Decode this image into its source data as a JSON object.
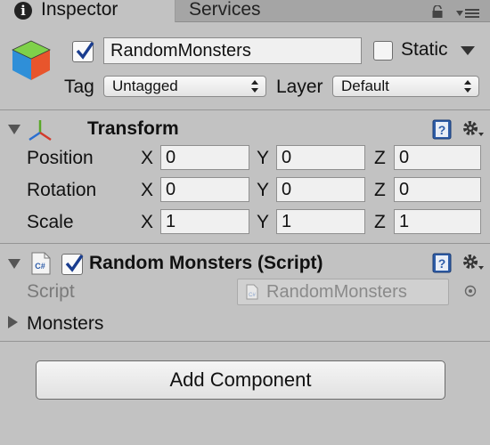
{
  "tabs": {
    "inspector": "Inspector",
    "services": "Services"
  },
  "header": {
    "object_name": "RandomMonsters",
    "static_label": "Static",
    "tag_label": "Tag",
    "tag_value": "Untagged",
    "layer_label": "Layer",
    "layer_value": "Default"
  },
  "transform": {
    "title": "Transform",
    "rows": [
      {
        "label": "Position",
        "x": "0",
        "y": "0",
        "z": "0"
      },
      {
        "label": "Rotation",
        "x": "0",
        "y": "0",
        "z": "0"
      },
      {
        "label": "Scale",
        "x": "1",
        "y": "1",
        "z": "1"
      }
    ],
    "axes": {
      "x": "X",
      "y": "Y",
      "z": "Z"
    }
  },
  "script_component": {
    "title": "Random Monsters (Script)",
    "script_label": "Script",
    "script_value": "RandomMonsters",
    "monsters_label": "Monsters",
    "icon_text": "C#"
  },
  "add_component_label": "Add Component"
}
